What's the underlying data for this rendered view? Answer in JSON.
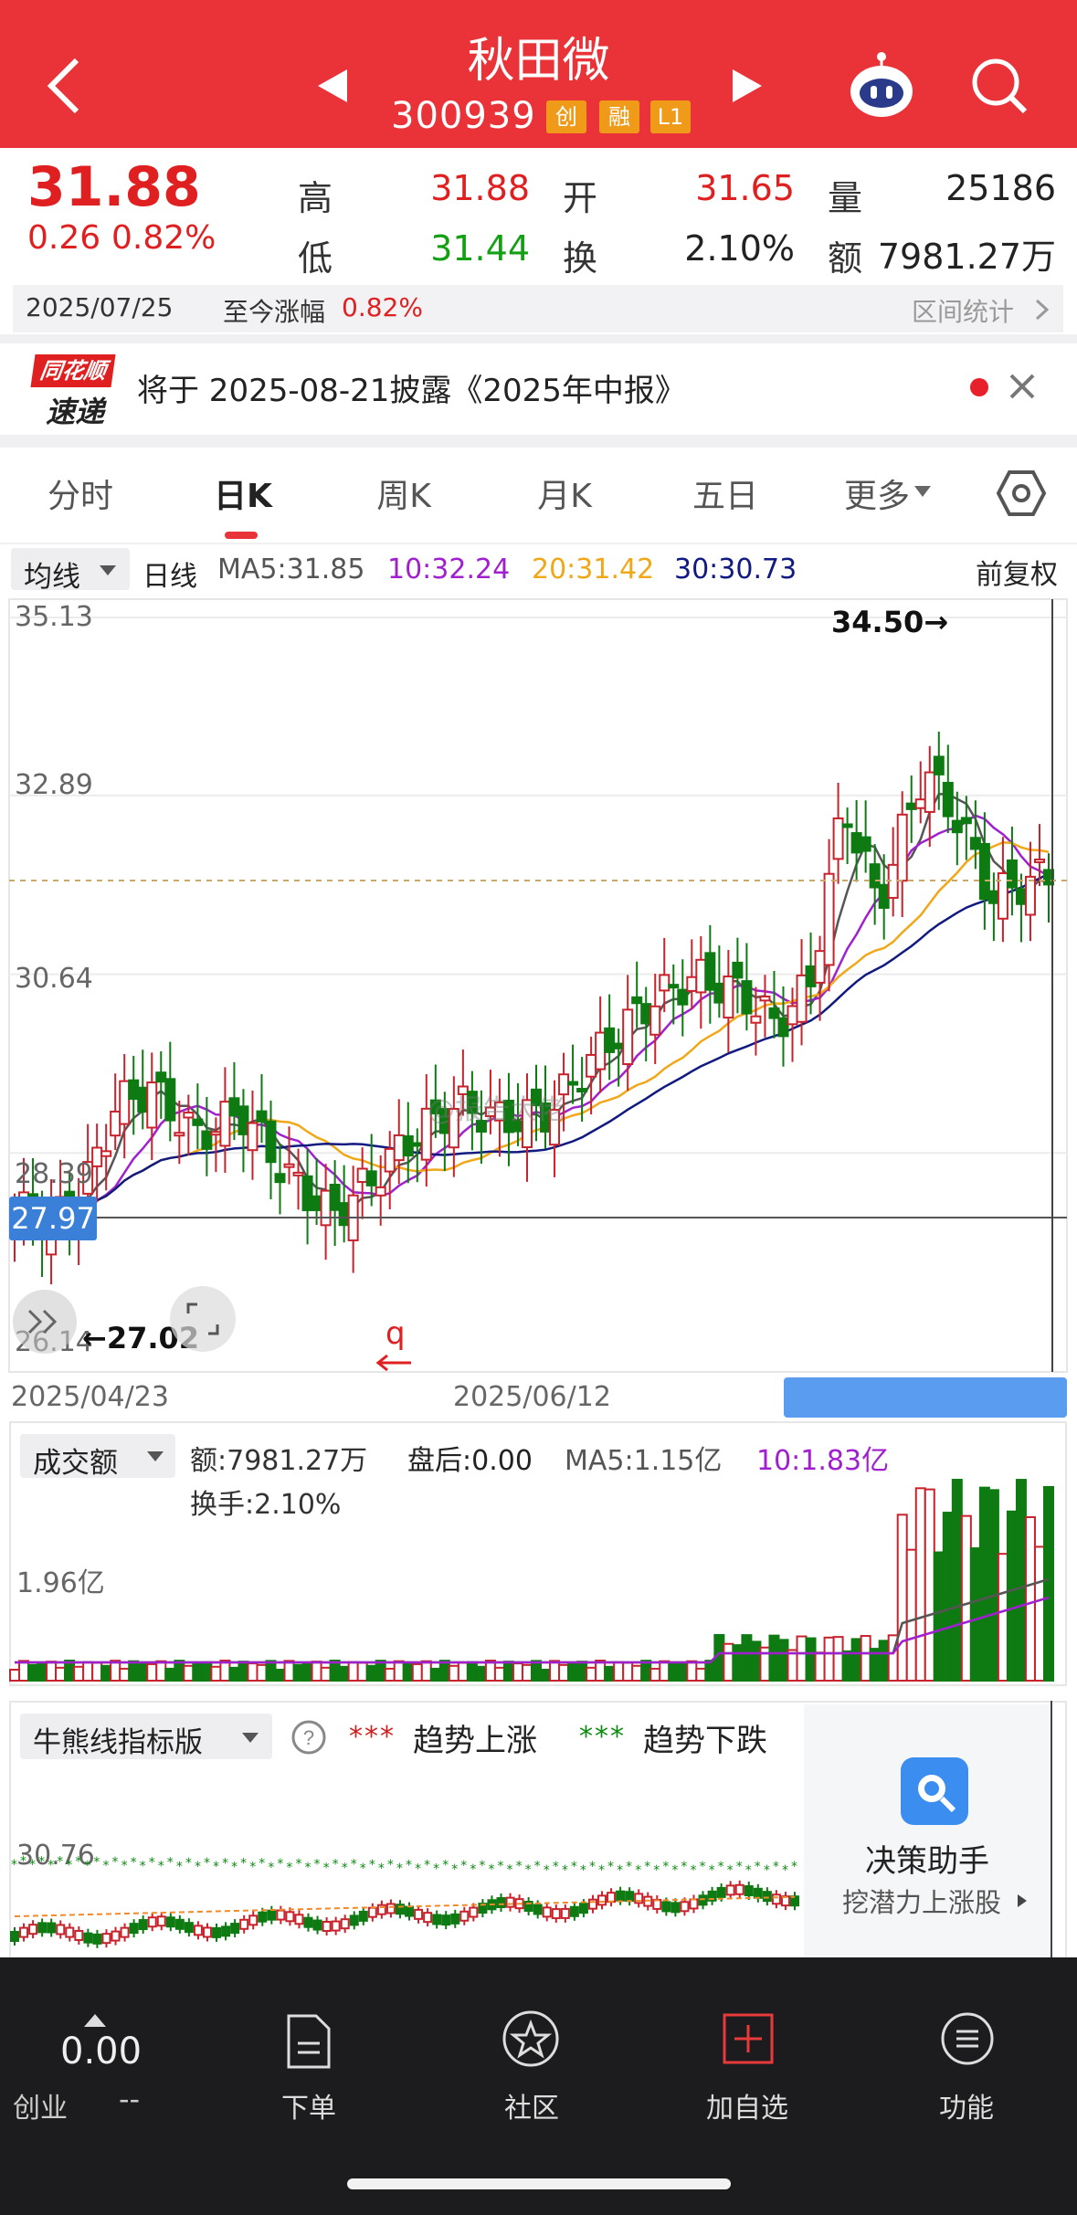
{
  "header": {
    "stock_name": "秋田微",
    "stock_code": "300939",
    "tags": [
      "创",
      "融",
      "L1"
    ]
  },
  "quote": {
    "price": "31.88",
    "change": "0.26",
    "change_pct": "0.82%",
    "high_label": "高",
    "high": "31.88",
    "low_label": "低",
    "low": "31.44",
    "open_label": "开",
    "open": "31.65",
    "turnover_label": "换",
    "turnover": "2.10%",
    "volume_label": "量",
    "volume": "25186",
    "amount_label": "额",
    "amount": "7981.27万"
  },
  "datebar": {
    "date": "2025/07/25",
    "since_label": "至今涨幅",
    "since_value": "0.82%",
    "range_stats": "区间统计"
  },
  "notice": {
    "logo_top": "同花顺",
    "logo_bottom": "速递",
    "text": "将于 2025-08-21披露《2025年中报》"
  },
  "tabs": [
    "分时",
    "日K",
    "周K",
    "月K",
    "五日",
    "更多"
  ],
  "active_tab": "日K",
  "ma_legend": {
    "selector": "均线",
    "period": "日线",
    "ma5": "MA5:31.85",
    "ma10": "10:32.24",
    "ma20": "20:31.42",
    "ma30": "30:30.73",
    "adjust": "前复权"
  },
  "kline": {
    "y_labels": [
      "35.13",
      "32.89",
      "30.64",
      "28.39",
      "26.14"
    ],
    "current_price_tag": "27.97",
    "high_annotation": "34.50→",
    "low_annotation": "←27.02",
    "marker": "q",
    "x_labels": [
      "2025/04/23",
      "2025/06/12"
    ]
  },
  "volume_panel": {
    "selector": "成交额",
    "amount": "额:7981.27万",
    "after_hours": "盘后:0.00",
    "ma5": "MA5:1.15亿",
    "ma10": "10:1.83亿",
    "turnover": "换手:2.10%",
    "y_label": "1.96亿"
  },
  "indicator_panel": {
    "selector": "牛熊线指标版",
    "up_label": "趋势上涨",
    "down_label": "趋势下跌",
    "y_label": "30.76",
    "assistant_title": "决策助手",
    "assistant_sub": "挖潜力上涨股"
  },
  "watermark": "@报告大佬",
  "bottom_nav": {
    "index_value": "0.00",
    "index_name": "创业",
    "index_change": "--",
    "items": [
      "下单",
      "社区",
      "加自选",
      "功能"
    ]
  },
  "colors": {
    "brand_red": "#ea3339",
    "up": "#c8232c",
    "down": "#0e7a12",
    "ma5": "#555555",
    "ma10": "#a020d0",
    "ma20": "#f0a818",
    "ma30": "#101a80"
  }
}
